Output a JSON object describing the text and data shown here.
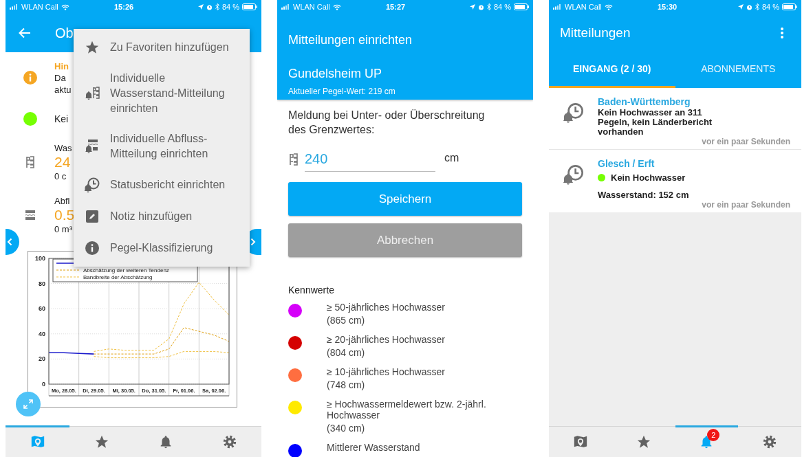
{
  "station_screen": {
    "status_bar": {
      "carrier": "WLAN Call",
      "time": "15:26",
      "battery": "84 %"
    },
    "header": {
      "title": "Ob"
    },
    "info_rows": [
      {
        "kind": "notice",
        "lines": [
          "Hin",
          "Da",
          "aktu"
        ]
      },
      {
        "kind": "status",
        "color": "#76ff03",
        "lines": [
          "Kei"
        ]
      },
      {
        "kind": "water_level",
        "lines": [
          "Was",
          "24",
          "0 c"
        ]
      },
      {
        "kind": "discharge",
        "lines": [
          "Abfl",
          "0.5",
          "0 m³"
        ]
      }
    ],
    "chart_data": {
      "type": "line",
      "categories": [
        null,
        "Mo, 28.05.",
        null,
        "Di, 29.05.",
        null,
        "Mi, 30.05.",
        null,
        "Do, 31.05.",
        null,
        "Fr, 01.06.",
        null,
        "Sa, 02.06.",
        null
      ],
      "ylim": [
        0,
        100
      ],
      "yticks": [
        0,
        20,
        40,
        60,
        80,
        100
      ],
      "grid": true,
      "legend": true,
      "series": [
        {
          "color": "#1a1acc",
          "line_style": "solid",
          "values": [
            25,
            25,
            24.5,
            24,
            null,
            null,
            null,
            null,
            null,
            null,
            null,
            null,
            null
          ]
        },
        {
          "name": "Abschätzung der weiteren Tendenz",
          "color": "#e0a010",
          "line_style": "dashed",
          "values": [
            null,
            null,
            null,
            24,
            24,
            24,
            24,
            24,
            28,
            45,
            42,
            39,
            34
          ]
        },
        {
          "name": "Bandbreite der Abschätzung",
          "color": "#f0c040",
          "line_style": "dashed",
          "values": [
            null,
            null,
            null,
            26,
            28,
            27,
            27,
            27,
            36,
            64,
            81,
            67,
            55
          ]
        },
        {
          "color": "#f0c040",
          "line_style": "dashed",
          "values": [
            null,
            null,
            null,
            22,
            21,
            21,
            21,
            21,
            22,
            26,
            26,
            26,
            25
          ]
        }
      ]
    },
    "menu": [
      {
        "kind": "favorite",
        "label": "Zu Favoriten hinzufügen"
      },
      {
        "kind": "level_alert",
        "label": "Individuelle Wasserstand-Mitteilung einrichten"
      },
      {
        "kind": "flow_alert",
        "label": "Individuelle Abfluss-Mitteilung einrichten"
      },
      {
        "kind": "status_report",
        "label": "Statusbericht einrichten"
      },
      {
        "kind": "note",
        "label": "Notiz hinzufügen"
      },
      {
        "kind": "classification",
        "label": "Pegel-Klassifizierung"
      }
    ],
    "nav": [
      {
        "kind": "map",
        "selected": true
      },
      {
        "kind": "favorites",
        "selected": false
      },
      {
        "kind": "alerts",
        "selected": false
      },
      {
        "kind": "settings",
        "selected": false
      }
    ]
  },
  "alert_setup_screen": {
    "status_bar": {
      "carrier": "WLAN Call",
      "time": "15:27",
      "battery": "84 %"
    },
    "title": "Mitteilungen einrichten",
    "station": "Gundelsheim UP",
    "current_value": "Aktueller Pegel-Wert: 219 cm",
    "prompt": "Meldung bei Unter- oder Überschreitung des Grenzwertes:",
    "threshold": {
      "value": "240",
      "unit": "cm"
    },
    "buttons": [
      {
        "kind": "primary",
        "label": "Speichern"
      },
      {
        "kind": "secondary",
        "label": "Abbrechen"
      }
    ],
    "legend": {
      "title": "Kennwerte",
      "items": [
        {
          "label": "≥ 50-jährliches Hochwasser",
          "value": "(865 cm)",
          "color": "#d500f9"
        },
        {
          "label": "≥ 20-jährliches Hochwasser",
          "value": "(804 cm)",
          "color": "#d50000"
        },
        {
          "label": "≥ 10-jährliches Hochwasser",
          "value": "(748 cm)",
          "color": "#ff6e40"
        },
        {
          "label": "≥ Hochwassermeldewert bzw. 2-jährl. Hochwasser",
          "value": "(340 cm)",
          "color": "#ffea00"
        },
        {
          "label": "Mittlerer Wasserstand",
          "color": "#0000ff"
        }
      ]
    }
  },
  "messages_screen": {
    "status_bar": {
      "carrier": "WLAN Call",
      "time": "15:30",
      "battery": "84 %"
    },
    "title": "Mitteilungen",
    "tabs": [
      {
        "label": "EINGANG (2 / 30)",
        "selected": true
      },
      {
        "label": "ABONNEMENTS",
        "selected": false
      }
    ],
    "messages": [
      {
        "title": "Baden-Württemberg",
        "body": "Kein Hochwasser an 311 Pegeln, kein Länderbericht vorhanden",
        "time": "vor ein paar Sekunden"
      },
      {
        "title": "Glesch / Erft",
        "status": {
          "color": "#76ff03",
          "label": "Kein Hochwasser"
        },
        "body": "Wasserstand: 152 cm",
        "time": "vor ein paar Sekunden"
      }
    ],
    "nav": [
      {
        "kind": "map",
        "selected": false
      },
      {
        "kind": "favorites",
        "selected": false
      },
      {
        "kind": "alerts",
        "selected": true,
        "badge": "2"
      },
      {
        "kind": "settings",
        "selected": false
      }
    ]
  }
}
